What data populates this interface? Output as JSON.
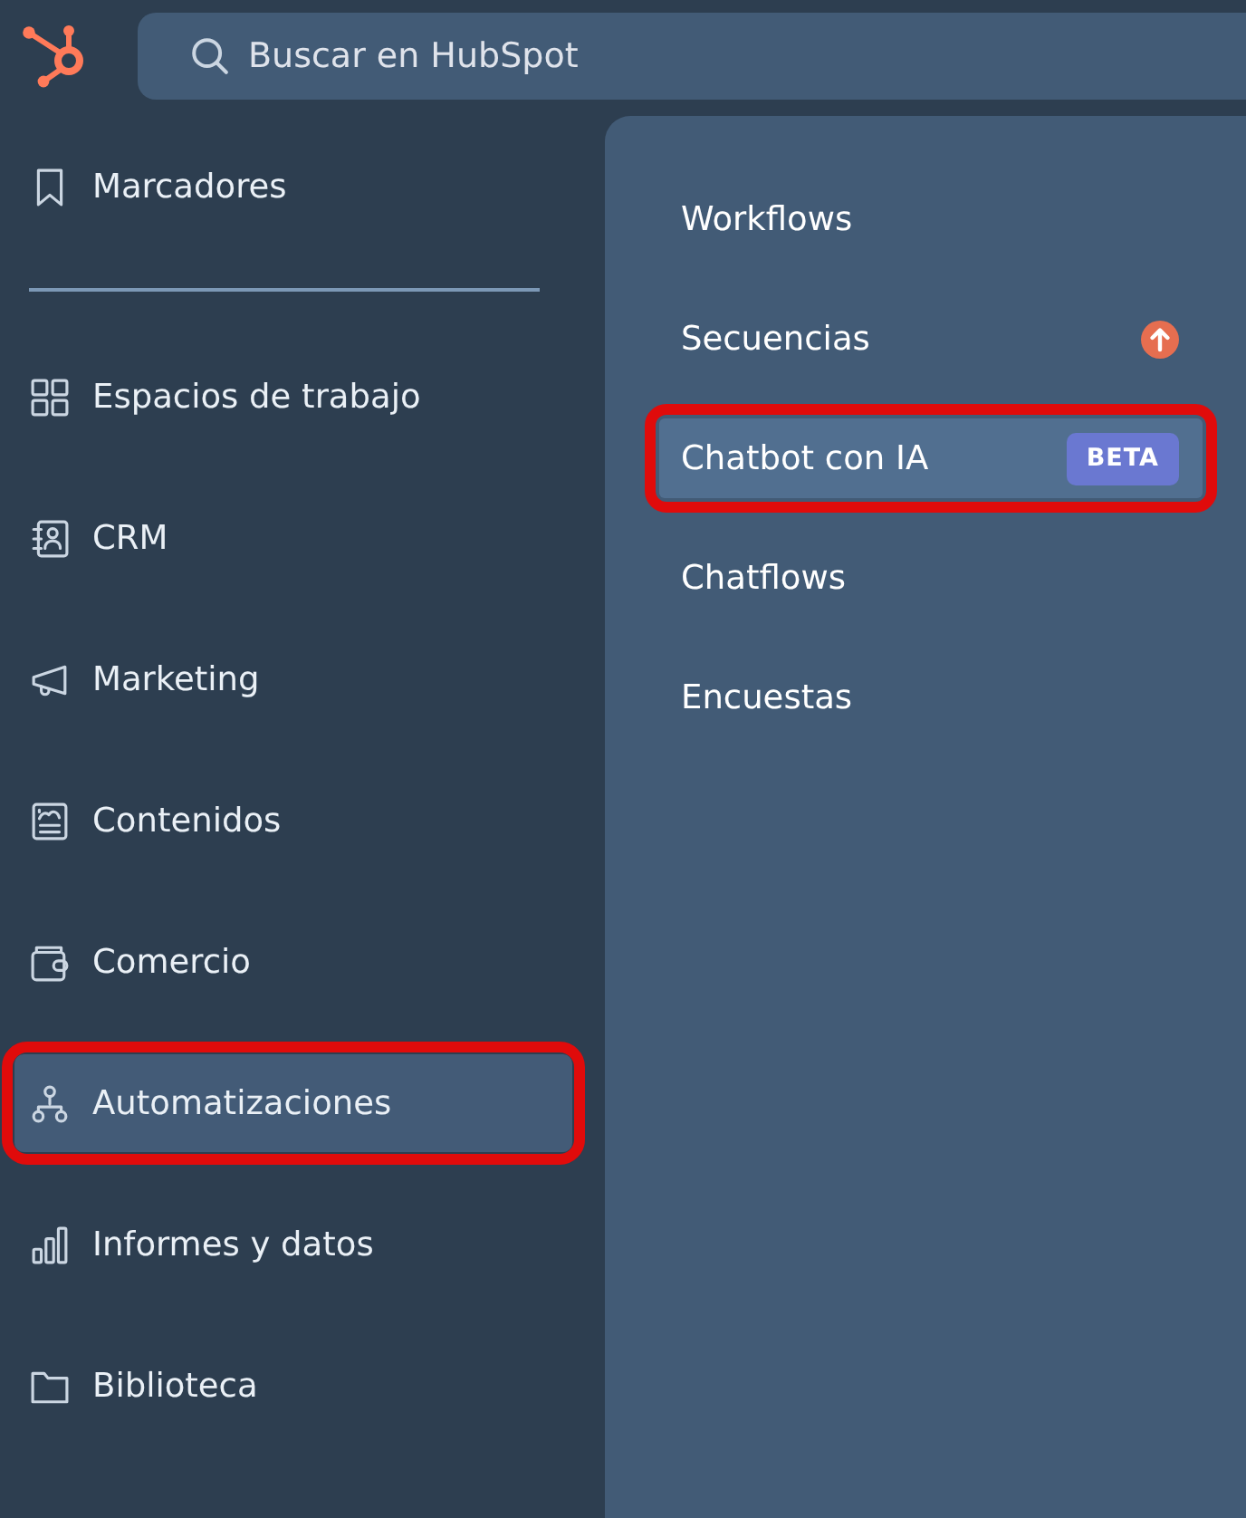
{
  "header": {
    "search": {
      "placeholder": "Buscar en HubSpot"
    }
  },
  "sidebar": {
    "top_item": {
      "label": "Marcadores"
    },
    "items": [
      {
        "label": "Espacios de trabajo",
        "selected": false,
        "annotated": false
      },
      {
        "label": "CRM",
        "selected": false,
        "annotated": false
      },
      {
        "label": "Marketing",
        "selected": false,
        "annotated": false
      },
      {
        "label": "Contenidos",
        "selected": false,
        "annotated": false
      },
      {
        "label": "Comercio",
        "selected": false,
        "annotated": false
      },
      {
        "label": "Automatizaciones",
        "selected": true,
        "annotated": true
      },
      {
        "label": "Informes y datos",
        "selected": false,
        "annotated": false
      },
      {
        "label": "Biblioteca",
        "selected": false,
        "annotated": false
      }
    ]
  },
  "submenu": {
    "items": [
      {
        "label": "Workflows",
        "selected": false,
        "annotated": false,
        "upgrade": false
      },
      {
        "label": "Secuencias",
        "selected": false,
        "annotated": false,
        "upgrade": true
      },
      {
        "label": "Chatbot con IA",
        "selected": true,
        "annotated": true,
        "upgrade": false,
        "badge": "BETA"
      },
      {
        "label": "Chatflows",
        "selected": false,
        "annotated": false,
        "upgrade": false
      },
      {
        "label": "Encuestas",
        "selected": false,
        "annotated": false,
        "upgrade": false
      }
    ]
  }
}
